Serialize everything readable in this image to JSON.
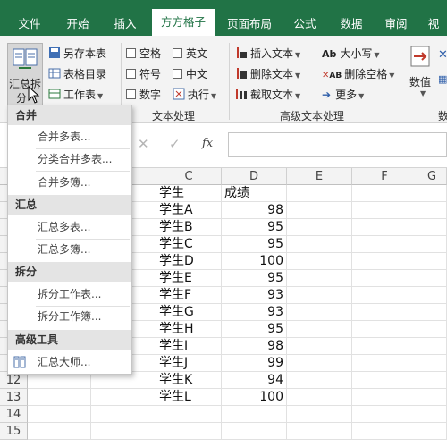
{
  "tabs": [
    "文件",
    "开始",
    "插入",
    "方方格子",
    "页面布局",
    "公式",
    "数据",
    "审阅",
    "视"
  ],
  "ribbon": {
    "merge_button": {
      "line1": "汇总拆",
      "line2": "分",
      "caret": "▾"
    },
    "quick": {
      "save_as": "另存本表",
      "table_index": "表格目录",
      "worksheet": "工作表"
    },
    "text_group": {
      "label": "文本处理",
      "space": "空格",
      "english": "英文",
      "symbol": "符号",
      "chinese": "中文",
      "digit": "数字",
      "execute": "执行"
    },
    "advanced_group": {
      "label": "高级文本处理",
      "insert_text": "插入文本",
      "delete_text": "删除文本",
      "cut_text": "截取文本",
      "case": "大小写",
      "case_prefix": "Ab",
      "delete_space": "删除空格",
      "delete_space_prefix": "AB",
      "more": "更多"
    },
    "number_group": {
      "value_button": "数值",
      "label": "数"
    }
  },
  "formula_bar": {
    "fx": "fx"
  },
  "grid": {
    "col_headers": [
      "C",
      "D",
      "E",
      "F",
      "G"
    ],
    "row_numbers": [
      "12",
      "13",
      "14",
      "15"
    ],
    "header_row": [
      "学生",
      "成绩"
    ],
    "rows": [
      [
        "学生A",
        "98"
      ],
      [
        "学生B",
        "95"
      ],
      [
        "学生C",
        "95"
      ],
      [
        "学生D",
        "100"
      ],
      [
        "学生E",
        "95"
      ],
      [
        "学生F",
        "93"
      ],
      [
        "学生G",
        "93"
      ],
      [
        "学生H",
        "95"
      ],
      [
        "学生I",
        "98"
      ],
      [
        "学生J",
        "99"
      ],
      [
        "学生K",
        "94"
      ],
      [
        "学生L",
        "100"
      ]
    ]
  },
  "menu": {
    "merge_header": "合并",
    "merge_sheets": "合并多表...",
    "category_merge": "分类合并多表...",
    "merge_books": "合并多簿...",
    "summary_header": "汇总",
    "summary_sheets": "汇总多表...",
    "summary_books": "汇总多簿...",
    "split_header": "拆分",
    "split_sheet": "拆分工作表...",
    "split_book": "拆分工作簿...",
    "advanced_header": "高级工具",
    "master": "汇总大师..."
  }
}
